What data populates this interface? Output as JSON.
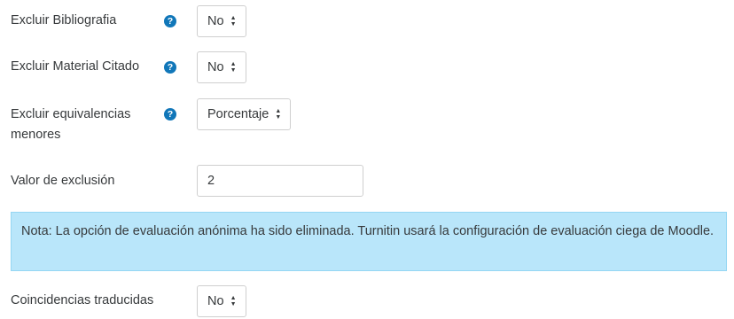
{
  "fields": {
    "excluir_bibliografia": {
      "label": "Excluir Bibliografia",
      "value": "No",
      "help_icon": "question-circle-icon"
    },
    "excluir_material_citado": {
      "label": "Excluir Material Citado",
      "value": "No",
      "help_icon": "question-circle-icon"
    },
    "excluir_equivalencias": {
      "label": "Excluir equivalencias menores",
      "value": "Porcentaje",
      "help_icon": "question-circle-icon"
    },
    "valor_exclusion": {
      "label": "Valor de exclusión",
      "value": "2"
    },
    "coincidencias_traducidas": {
      "label": "Coincidencias traducidas",
      "value": "No"
    }
  },
  "note": {
    "text": "Nota: La opción de evaluación anónima ha sido eliminada. Turnitin usará la configuración de evaluación ciega de Moodle."
  },
  "icons": {
    "help": "?",
    "caret": "▲▼"
  },
  "colors": {
    "help_icon": "#1177b9",
    "note_background": "#b9e6fa"
  }
}
